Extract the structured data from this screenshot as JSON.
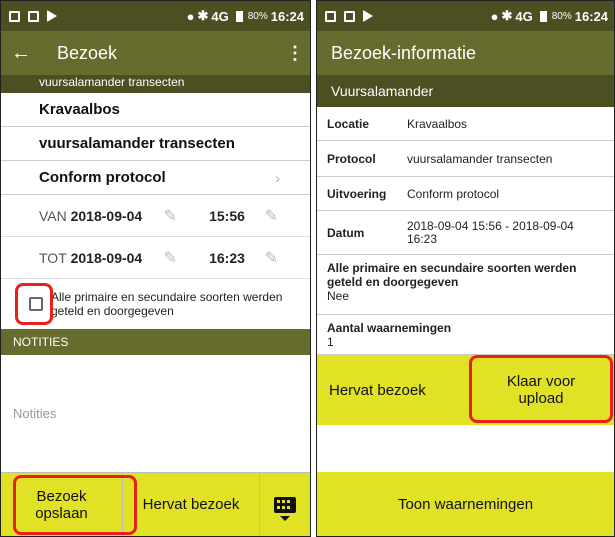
{
  "left_screen": {
    "statusbar": {
      "network": "4G",
      "battery": "80%",
      "time": "16:24"
    },
    "appbar": {
      "back_icon": "arrow-left-icon",
      "title": "Bezoek",
      "menu_icon": "more-vert-icon"
    },
    "subheader": "vuursalamander transecten",
    "fields": {
      "location": "Kravaalbos",
      "protocol": "vuursalamander transecten",
      "execution": "Conform protocol"
    },
    "from": {
      "label": "VAN",
      "date": "2018-09-04",
      "time": "15:56"
    },
    "to": {
      "label": "TOT",
      "date": "2018-09-04",
      "time": "16:23"
    },
    "checkbox_label": "Alle primaire en secundaire soorten werden geteld en doorgegeven",
    "notes_header": "NOTITIES",
    "notes_placeholder": "Notities",
    "buttons": {
      "save_line1": "Bezoek",
      "save_line2": "opslaan",
      "resume": "Hervat bezoek"
    }
  },
  "right_screen": {
    "statusbar": {
      "network": "4G",
      "battery": "80%",
      "time": "16:24"
    },
    "appbar": {
      "title": "Bezoek-informatie"
    },
    "species": "Vuursalamander",
    "rows": [
      {
        "key": "Locatie",
        "value": "Kravaalbos"
      },
      {
        "key": "Protocol",
        "value": "vuursalamander transecten"
      },
      {
        "key": "Uitvoering",
        "value": "Conform protocol"
      },
      {
        "key": "Datum",
        "value": "2018-09-04 15:56 - 2018-09-04 16:23"
      }
    ],
    "all_species": {
      "key": "Alle primaire en secundaire soorten werden geteld en doorgegeven",
      "value": "Nee"
    },
    "observations": {
      "key": "Aantal waarnemingen",
      "value": "1"
    },
    "buttons": {
      "resume": "Hervat bezoek",
      "ready_line1": "Klaar voor",
      "ready_line2": "upload",
      "show": "Toon waarnemingen"
    }
  },
  "colors": {
    "appbar": "#666b2e",
    "statusbar": "#4c4f21",
    "action": "#e1e125",
    "highlight": "#e8201c"
  }
}
